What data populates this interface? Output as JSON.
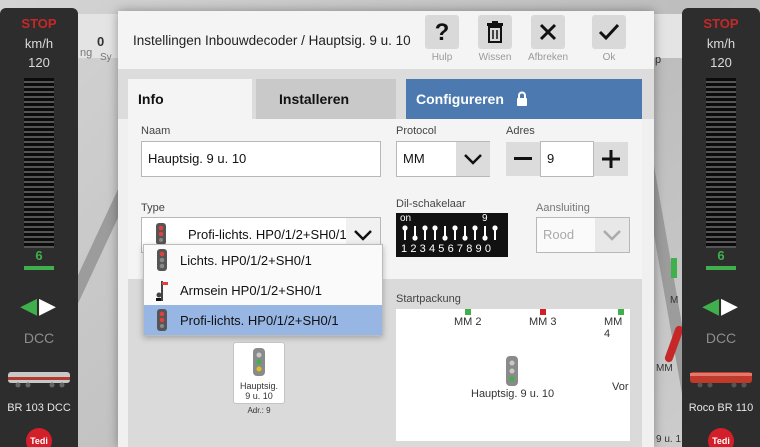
{
  "background": {
    "left_throttle": {
      "stop": "STOP",
      "unit": "km/h",
      "speed": "120",
      "step": "6",
      "mode": "DCC",
      "name": "BR 103 DCC"
    },
    "right_throttle": {
      "stop": "STOP",
      "unit": "km/h",
      "speed": "120",
      "step": "6",
      "mode": "DCC",
      "name": "Roco BR 110"
    },
    "frag_left_0": "0",
    "frag_left_ng": "ng",
    "frag_left_sy": "Sy",
    "frag_right_p": "p",
    "frag_right_m": "M",
    "frag_right_mm": "MM",
    "frag_right_bottom": "9 u. 1",
    "logo_text": "Tedi"
  },
  "dialog": {
    "title": "Instellingen Inbouwdecoder / Hauptsig. 9 u. 10",
    "buttons": {
      "help": {
        "icon": "question-icon",
        "label": "Hulp"
      },
      "delete": {
        "icon": "trash-icon",
        "label": "Wissen"
      },
      "cancel": {
        "icon": "close-icon",
        "label": "Afbreken"
      },
      "ok": {
        "icon": "check-icon",
        "label": "Ok"
      }
    },
    "tabs": {
      "info": "Info",
      "install": "Installeren",
      "configure": "Configureren"
    },
    "form": {
      "name_label": "Naam",
      "name_value": "Hauptsig. 9 u. 10",
      "protocol_label": "Protocol",
      "protocol_value": "MM",
      "address_label": "Adres",
      "address_value": "9",
      "type_label": "Type",
      "type_value": "Profi-lichts. HP0/1/2+SH0/1",
      "dip_label": "Dil-schakelaar",
      "dip_on": "on",
      "dip_nine": "9",
      "dip_numbers": "1234567890",
      "connection_label": "Aansluiting",
      "connection_value": "Rood"
    },
    "type_options": [
      {
        "label": "Lichts. HP0/1/2+SH0/1",
        "selected": false
      },
      {
        "label": "Armsein HP0/1/2+SH0/1",
        "selected": false
      },
      {
        "label": "Profi-lichts. HP0/1/2+SH0/1",
        "selected": true
      }
    ],
    "startpack": {
      "label": "Startpackung",
      "mm_labels": [
        "MM 2",
        "MM 3",
        "MM 4"
      ],
      "signal_name": "Hauptsig. 9 u. 10",
      "partial_label": "Vor"
    },
    "card": {
      "name_line1": "Hauptsig.",
      "name_line2": "9 u. 10",
      "address": "Adr.: 9"
    },
    "colors": {
      "accent": "#4c7ab0",
      "selection": "#97b6e4",
      "green": "#3fb04b",
      "red": "#d21f2a"
    }
  }
}
